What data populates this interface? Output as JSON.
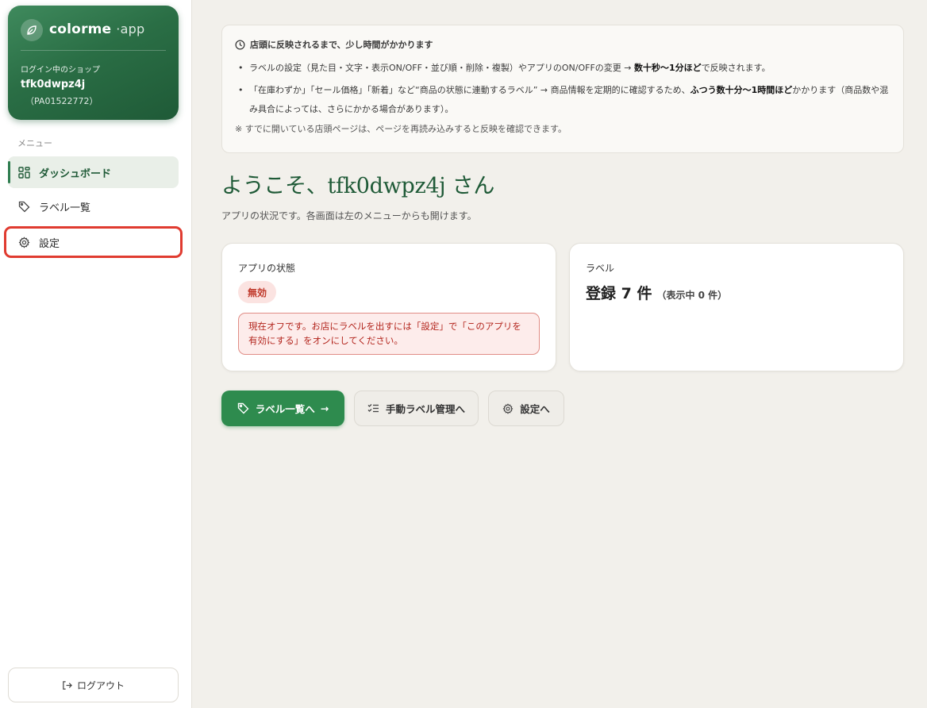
{
  "brand": {
    "name": "colorme",
    "suffix": "·app"
  },
  "shop": {
    "caption": "ログイン中のショップ",
    "name": "tfk0dwpz4j",
    "id": "（PA01522772）"
  },
  "menu": {
    "caption": "メニュー",
    "items": [
      {
        "label": "ダッシュボード",
        "icon": "dashboard-icon"
      },
      {
        "label": "ラベル一覧",
        "icon": "tag-icon"
      },
      {
        "label": "設定",
        "icon": "gear-icon"
      }
    ]
  },
  "logout_label": "ログアウト",
  "notice": {
    "title": "店頭に反映されるまで、少し時間がかかります",
    "item1_pre": "ラベルの設定（見た目・文字・表示ON/OFF・並び順・削除・複製）やアプリのON/OFFの変更 → ",
    "item1_bold": "数十秒〜1分ほど",
    "item1_post": "で反映されます。",
    "item2_pre": "「在庫わずか」「セール価格」「新着」など“商品の状態に連動するラベル” → 商品情報を定期的に確認するため、",
    "item2_bold": "ふつう数十分〜1時間ほど",
    "item2_post": "かかります（商品数や混み具合によっては、さらにかかる場合があります）。",
    "note": "※ すでに開いている店頭ページは、ページを再読み込みすると反映を確認できます。"
  },
  "welcome": "ようこそ、tfk0dwpz4j さん",
  "subtitle": "アプリの状況です。各画面は左のメニューからも開けます。",
  "status_card": {
    "title": "アプリの状態",
    "badge": "無効",
    "alert": "現在オフです。お店にラベルを出すには「設定」で「このアプリを有効にする」をオンにしてください。"
  },
  "label_card": {
    "title": "ラベル",
    "count": "登録 7 件",
    "sub": "（表示中 0 件）"
  },
  "actions": {
    "primary": "ラベル一覧へ",
    "primary_arrow": "→",
    "manual": "手動ラベル管理へ",
    "settings": "設定へ"
  },
  "colors": {
    "brand_green": "#2e8b4e",
    "dark_green": "#1f5a37",
    "danger": "#c0392b",
    "highlight_red": "#e03b30"
  }
}
